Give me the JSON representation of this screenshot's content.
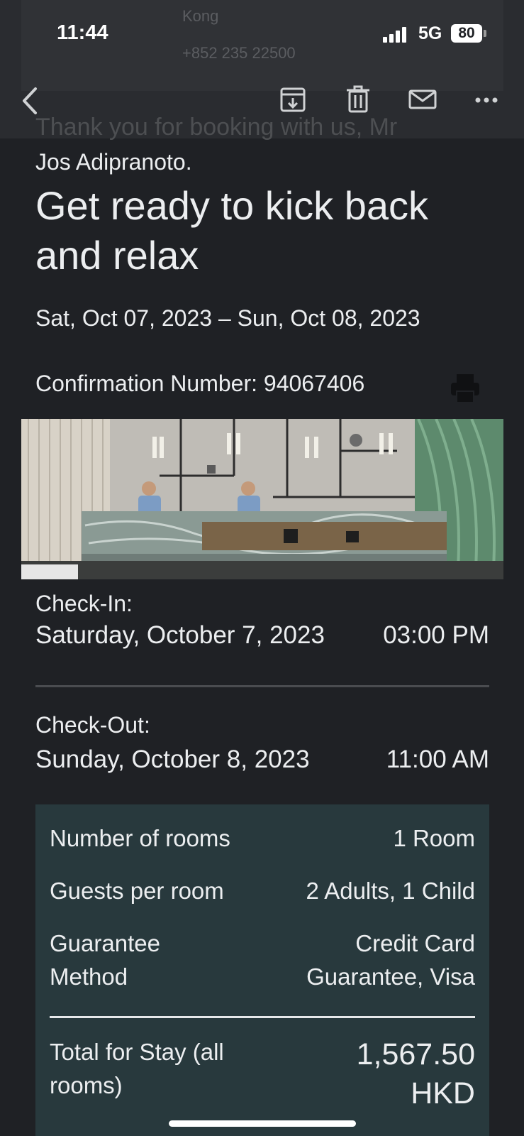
{
  "status_bar": {
    "time": "11:44",
    "network": "5G",
    "battery": "80"
  },
  "header_ghost": {
    "line1": "Kong",
    "line2": "+852 235 22500"
  },
  "toolbar": {
    "back_icon": "chevron-left-icon",
    "archive_icon": "archive-icon",
    "trash_icon": "trash-icon",
    "mail_icon": "mail-icon",
    "more_icon": "more-icon"
  },
  "email": {
    "thanks_partial": "Thank you for booking with us, Mr",
    "greeting_name": "Jos Adipranoto.",
    "headline": "Get ready to kick back and relax",
    "date_range": "Sat, Oct 07, 2023 – Sun, Oct 08, 2023",
    "confirmation": "Confirmation Number: 94067406",
    "printer_icon": "printer-icon",
    "check_in": {
      "label": "Check-In:",
      "date": "Saturday, October 7, 2023",
      "time": "03:00 PM"
    },
    "check_out": {
      "label": "Check-Out:",
      "date": "Sunday, October 8, 2023",
      "time": "11:00 AM"
    },
    "summary": {
      "rooms_label": "Number of rooms",
      "rooms_value": "1 Room",
      "guests_label": "Guests per room",
      "guests_value": "2 Adults, 1 Child",
      "guarantee_label": "Guarantee Method",
      "guarantee_value": "Credit Card Guarantee, Visa",
      "total_label": "Total for Stay (all rooms)",
      "total_value": "1,567.50 HKD"
    }
  },
  "colors": {
    "background": "#1f2125",
    "toolbar": "#2a2c30",
    "card": "#28393d",
    "text": "#eceef0"
  }
}
